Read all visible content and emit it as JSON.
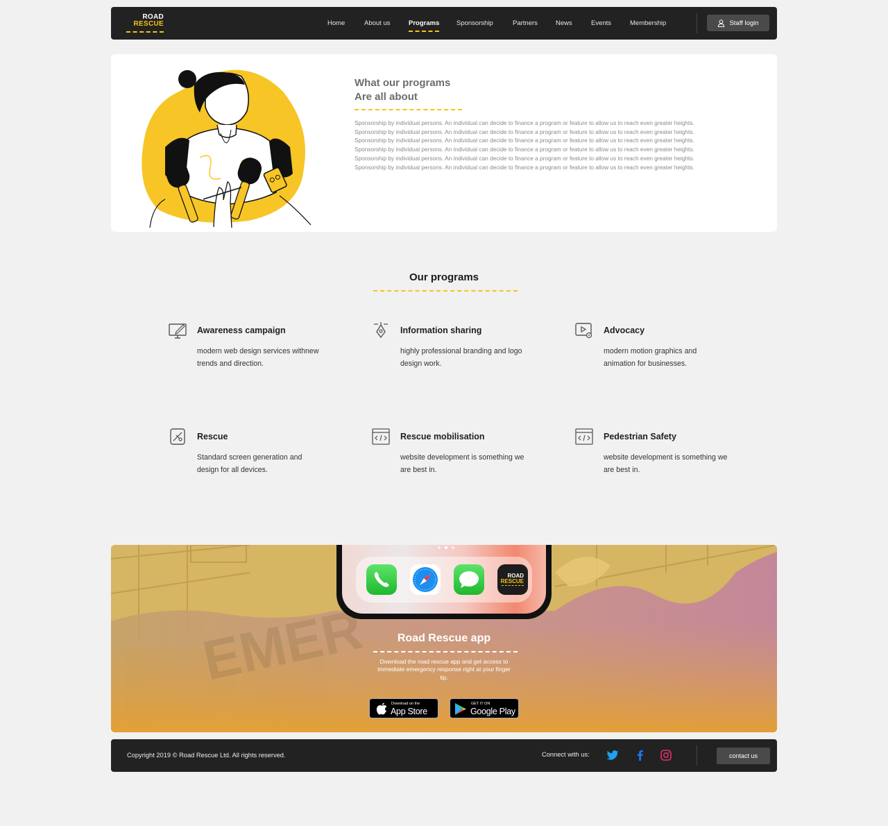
{
  "nav": {
    "logo_line1": "ROAD",
    "logo_line2": "RESCUE",
    "links": [
      "Home",
      "About us",
      "Programs",
      "Sponsorship",
      "Partners",
      "News",
      "Events",
      "Membership"
    ],
    "active": "Programs",
    "staff_login": "Staff login"
  },
  "hero": {
    "title_line1": "What our programs",
    "title_line2": "Are all about",
    "text": "Sponsorship by individual persons. An individual can decide to finance a program or feature to allow us to reach even greater heights.  Sponsorship by individual persons. An individual can decide to finance a program or feature to allow us to reach even greater heights.  Sponsorship by individual persons. An individual can decide to finance a program or feature to allow us to reach even greater heights.  Sponsorship by individual persons. An individual can decide to finance a program or feature to allow us to reach even greater heights.  Sponsorship by individual persons. An individual can decide to finance a program or feature to allow us to reach even greater heights.  Sponsorship by individual persons. An individual can decide to finance a program or feature to allow us to reach even greater heights."
  },
  "programs": {
    "title": "Our programs",
    "items": [
      {
        "title": "Awareness campaign",
        "desc": "modern web design services withnew trends and direction.",
        "icon": "monitor-edit-icon"
      },
      {
        "title": "Information sharing",
        "desc": "highly professional branding and logo design work.",
        "icon": "pen-tool-icon"
      },
      {
        "title": "Advocacy",
        "desc": "modern motion graphics and animation for businesses.",
        "icon": "video-settings-icon"
      },
      {
        "title": "Rescue",
        "desc": "Standard screen generation and design for all devices.",
        "icon": "devices-icon"
      },
      {
        "title": "Rescue mobilisation",
        "desc": "website development is something we are best in.",
        "icon": "code-window-icon"
      },
      {
        "title": "Pedestrian Safety",
        "desc": "website development is something we are best in.",
        "icon": "code-window-icon"
      }
    ]
  },
  "app": {
    "title": "Road Rescue app",
    "desc": "Download the road rescue app and get access to immediate emergency response right at your finger tip.",
    "icon_logo_line1": "ROAD",
    "icon_logo_line2": "RESCUE",
    "appstore_small": "Download on the",
    "appstore_big": "App Store",
    "googleplay_small": "GET IT ON",
    "googleplay_big": "Google Play",
    "background_letters": "EMER"
  },
  "footer": {
    "copyright": "Copyright 2019 © Road Rescue Ltd.  All rights reserved.",
    "connect": "Connect with us:",
    "contact": "contact us",
    "social_icons": [
      "twitter-icon",
      "facebook-icon",
      "instagram-icon"
    ]
  },
  "colors": {
    "accent": "#f5c518",
    "dark": "#222222",
    "twitter": "#1da1f2",
    "facebook": "#1877f2",
    "instagram": "#e1306c"
  }
}
